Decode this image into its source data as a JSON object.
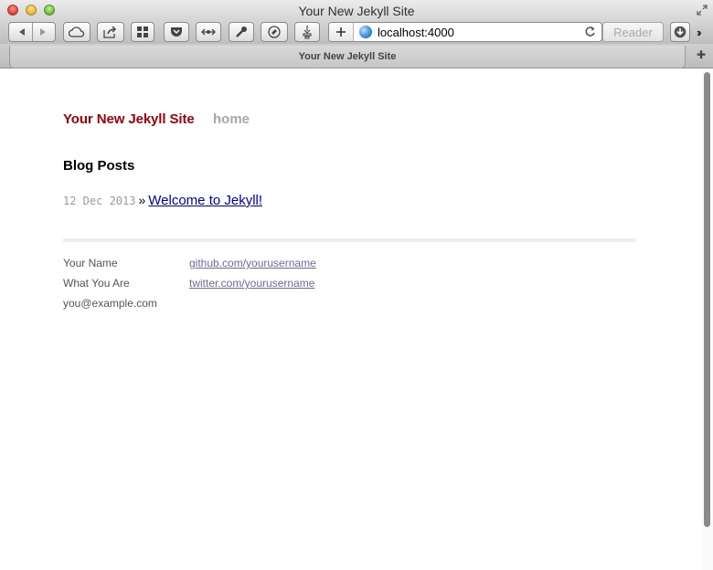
{
  "window": {
    "title": "Your New Jekyll Site",
    "tab_title": "Your New Jekyll Site"
  },
  "toolbar": {
    "url": "localhost:4000",
    "reader_label": "Reader",
    "icons": [
      "back-icon",
      "forward-icon",
      "icloud-icon",
      "share-icon",
      "top-sites-icon",
      "pocket-icon",
      "connect-icon",
      "tools-icon",
      "evernote-icon",
      "bookmark-icon",
      "add-icon",
      "globe-icon",
      "reload-icon",
      "download-icon",
      "chevrons-icon",
      "new-tab-icon"
    ]
  },
  "site": {
    "title": "Your New Jekyll Site",
    "nav_home": "home"
  },
  "main": {
    "heading": "Blog Posts",
    "posts": [
      {
        "date": "12 Dec 2013",
        "separator": "»",
        "title": "Welcome to Jekyll!"
      }
    ]
  },
  "footer": {
    "name": "Your Name",
    "role": "What You Are",
    "email": "you@example.com",
    "github": "github.com/yourusername",
    "twitter": "twitter.com/yourusername"
  },
  "colors": {
    "site_title": "#a0000a",
    "nav": "#a6a6a6",
    "post_link": "#0000b0",
    "footer_link": "#6a6aa6"
  }
}
